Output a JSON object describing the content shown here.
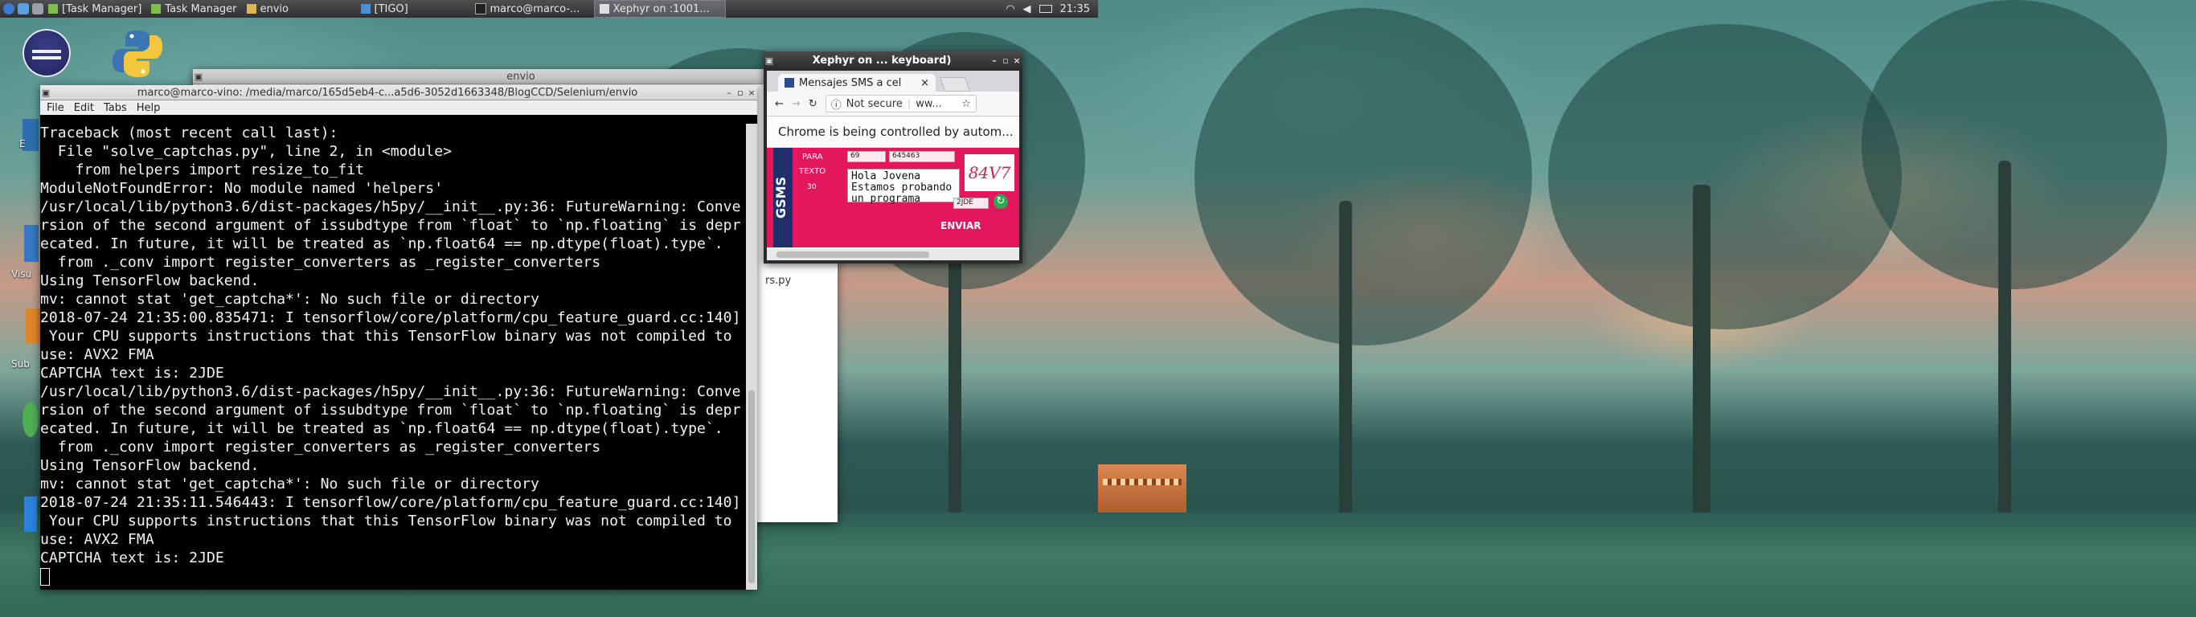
{
  "panel": {
    "tasks": [
      {
        "label": "[Task Manager]",
        "icon": "task-manager-icon"
      },
      {
        "label": "Task Manager",
        "icon": "task-manager-icon"
      },
      {
        "label": "envio",
        "icon": "folder-icon"
      },
      {
        "label": "[TIGO]",
        "icon": "folder-icon"
      },
      {
        "label": "marco@marco-...",
        "icon": "terminal-icon"
      },
      {
        "label": "Xephyr on :1001...",
        "icon": "xephyr-icon"
      }
    ],
    "clock": "21:35"
  },
  "desktop": {
    "side_labels": [
      "E",
      "Visu",
      "Sub"
    ]
  },
  "envio_window": {
    "title": "envio",
    "file_label": "rs.py"
  },
  "terminal": {
    "title": "marco@marco-vino: /media/marco/165d5eb4-c...a5d6-3052d1663348/BlogCCD/Selenium/envio",
    "menu": [
      "File",
      "Edit",
      "Tabs",
      "Help"
    ],
    "lines": [
      "Traceback (most recent call last):",
      "  File \"solve_captchas.py\", line 2, in <module>",
      "    from helpers import resize_to_fit",
      "ModuleNotFoundError: No module named 'helpers'",
      "/usr/local/lib/python3.6/dist-packages/h5py/__init__.py:36: FutureWarning: Conve",
      "rsion of the second argument of issubdtype from `float` to `np.floating` is depr",
      "ecated. In future, it will be treated as `np.float64 == np.dtype(float).type`.",
      "  from ._conv import register_converters as _register_converters",
      "Using TensorFlow backend.",
      "mv: cannot stat 'get_captcha*': No such file or directory",
      "2018-07-24 21:35:00.835471: I tensorflow/core/platform/cpu_feature_guard.cc:140]",
      " Your CPU supports instructions that this TensorFlow binary was not compiled to",
      "use: AVX2 FMA",
      "CAPTCHA text is: 2JDE",
      "/usr/local/lib/python3.6/dist-packages/h5py/__init__.py:36: FutureWarning: Conve",
      "rsion of the second argument of issubdtype from `float` to `np.floating` is depr",
      "ecated. In future, it will be treated as `np.float64 == np.dtype(float).type`.",
      "  from ._conv import register_converters as _register_converters",
      "Using TensorFlow backend.",
      "mv: cannot stat 'get_captcha*': No such file or directory",
      "2018-07-24 21:35:11.546443: I tensorflow/core/platform/cpu_feature_guard.cc:140]",
      " Your CPU supports instructions that this TensorFlow binary was not compiled to",
      "use: AVX2 FMA",
      "CAPTCHA text is: 2JDE"
    ]
  },
  "xephyr": {
    "title": "Xephyr on ... keyboard)",
    "chrome": {
      "tab_title": "Mensajes SMS a cel",
      "not_secure": "Not secure",
      "url": "ww...",
      "infobar": "Chrome is being controlled by autom...",
      "page": {
        "side_text": "GSMS",
        "para_label": "PARA",
        "para_code": "69",
        "para_number": "645463",
        "texto_label": "TEXTO",
        "counter": "30",
        "message": "Hola Jovena\nEstamos probando\nun programa",
        "captcha": "84V7",
        "captcha_input": "2JDE",
        "send_button": "ENVIAR"
      }
    }
  }
}
